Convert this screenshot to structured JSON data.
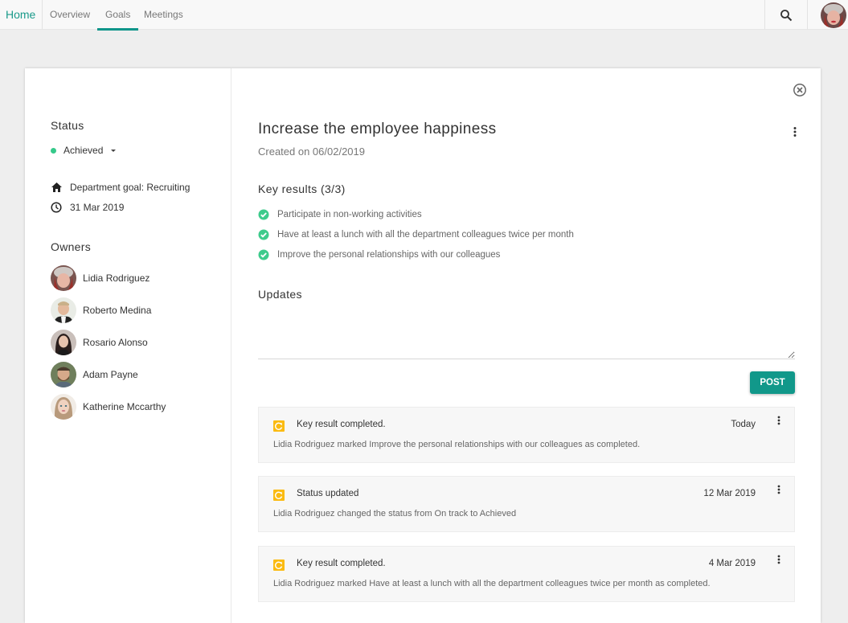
{
  "nav": {
    "brand": "Home",
    "tabs": [
      {
        "label": "Overview",
        "active": false
      },
      {
        "label": "Goals",
        "active": true
      },
      {
        "label": "Meetings",
        "active": false
      }
    ],
    "search_icon": "search-icon",
    "user_avatar": "user-avatar"
  },
  "sidebar": {
    "status_heading": "Status",
    "status_value": "Achieved",
    "status_color": "#35c98a",
    "department_goal": "Department goal: Recruiting",
    "due_date": "31 Mar 2019",
    "owners_heading": "Owners",
    "owners": [
      {
        "name": "Lidia Rodriguez"
      },
      {
        "name": "Roberto Medina"
      },
      {
        "name": "Rosario Alonso"
      },
      {
        "name": "Adam Payne"
      },
      {
        "name": "Katherine Mccarthy"
      }
    ]
  },
  "goal": {
    "title": "Increase the employee happiness",
    "created": "Created on 06/02/2019",
    "key_results_heading": "Key results (3/3)",
    "key_results": [
      {
        "text": "Participate in non-working activities",
        "done": true
      },
      {
        "text": "Have at least a lunch with all the department colleagues twice per month",
        "done": true
      },
      {
        "text": "Improve the personal relationships with our colleagues",
        "done": true
      }
    ],
    "updates_heading": "Updates",
    "updates_input_value": "",
    "post_label": "POST",
    "accent_color": "#11988a"
  },
  "updates": [
    {
      "title": "Key result completed.",
      "date": "Today",
      "body": "Lidia Rodriguez marked Improve the personal relationships with our colleagues as completed."
    },
    {
      "title": "Status updated",
      "date": "12 Mar 2019",
      "body": "Lidia Rodriguez changed the status from On track to Achieved"
    },
    {
      "title": "Key result completed.",
      "date": "4 Mar 2019",
      "body": "Lidia Rodriguez marked Have at least  a lunch with all the department colleagues twice per month as completed."
    }
  ]
}
